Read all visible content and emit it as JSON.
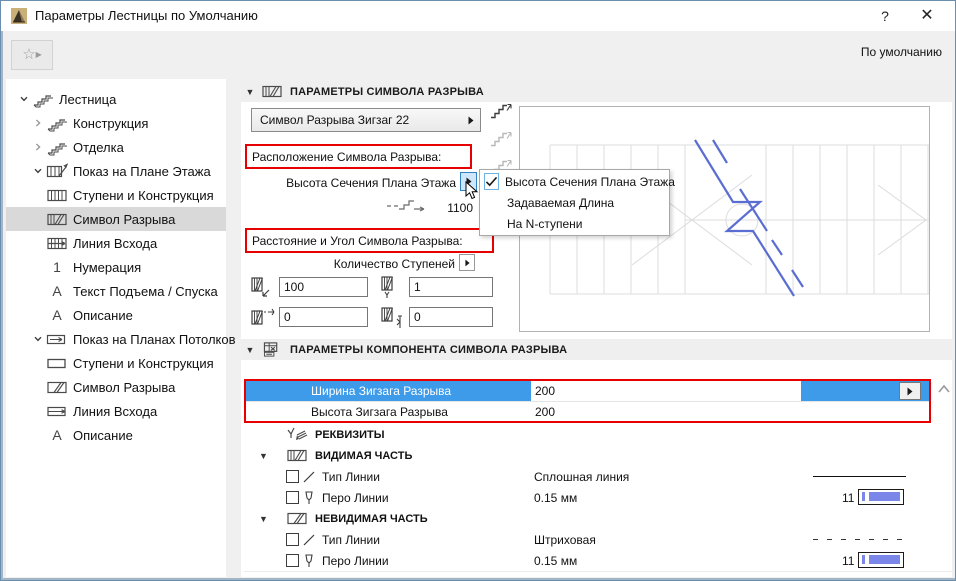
{
  "window": {
    "title": "Параметры Лестницы по Умолчанию",
    "help": "?",
    "close": "✕"
  },
  "toolbar": {
    "default_label": "По умолчанию"
  },
  "tree": {
    "items": [
      {
        "label": "Лестница"
      },
      {
        "label": "Конструкция"
      },
      {
        "label": "Отделка"
      },
      {
        "label": "Показ на Плане Этажа"
      },
      {
        "label": "Ступени и Конструкция"
      },
      {
        "label": "Символ Разрыва"
      },
      {
        "label": "Линия Всхода"
      },
      {
        "label": "Нумерация"
      },
      {
        "label": "Текст Подъема / Спуска"
      },
      {
        "label": "Описание"
      },
      {
        "label": "Показ на Планах Потолков"
      },
      {
        "label": "Ступени и Конструкция"
      },
      {
        "label": "Символ Разрыва"
      },
      {
        "label": "Линия Всхода"
      },
      {
        "label": "Описание"
      }
    ]
  },
  "section1": {
    "title": "ПАРАМЕТРЫ СИМВОЛА РАЗРЫВА",
    "dropdown": "Символ Разрыва Зигзаг 22",
    "placement_label": "Расположение Символа Разрыва:",
    "height_label": "Высота Сечения Плана Этажа",
    "height_value": "1100",
    "distance_label": "Расстояние и Угол Символа Разрыва:",
    "steps_label": "Количество Ступеней",
    "inputs": {
      "dist_x": "100",
      "dist_y": "1",
      "angle_a": "0",
      "angle_b": "0"
    }
  },
  "menu": {
    "items": [
      {
        "label": "Высота Сечения Плана Этажа",
        "checked": true
      },
      {
        "label": "Задаваемая Длина",
        "checked": false
      },
      {
        "label": "На N-ступени",
        "checked": false
      }
    ]
  },
  "section2": {
    "title": "ПАРАМЕТРЫ КОМПОНЕНТА СИМВОЛА РАЗРЫВА",
    "table": [
      {
        "name": "Ширина Зигзага Разрыва",
        "value": "200",
        "selected": true
      },
      {
        "name": "Высота Зигзага Разрыва",
        "value": "200",
        "selected": false
      }
    ],
    "attributes_header": "РЕКВИЗИТЫ",
    "visible": {
      "title": "ВИДИМАЯ ЧАСТЬ",
      "linetype_label": "Тип Линии",
      "linetype_value": "Сплошная линия",
      "pen_label": "Перо Линии",
      "pen_value": "0.15 мм",
      "pen_number": "11"
    },
    "invisible": {
      "title": "НЕВИДИМАЯ ЧАСТЬ",
      "linetype_label": "Тип Линии",
      "linetype_value": "Штриховая",
      "pen_label": "Перо Линии",
      "pen_value": "0.15 мм",
      "pen_number": "11"
    }
  },
  "colors": {
    "selection_blue": "#3d9bea",
    "highlight_red": "#e80000",
    "zigzag_blue": "#5a6ed2",
    "pen_blue": "#7b87e8"
  }
}
